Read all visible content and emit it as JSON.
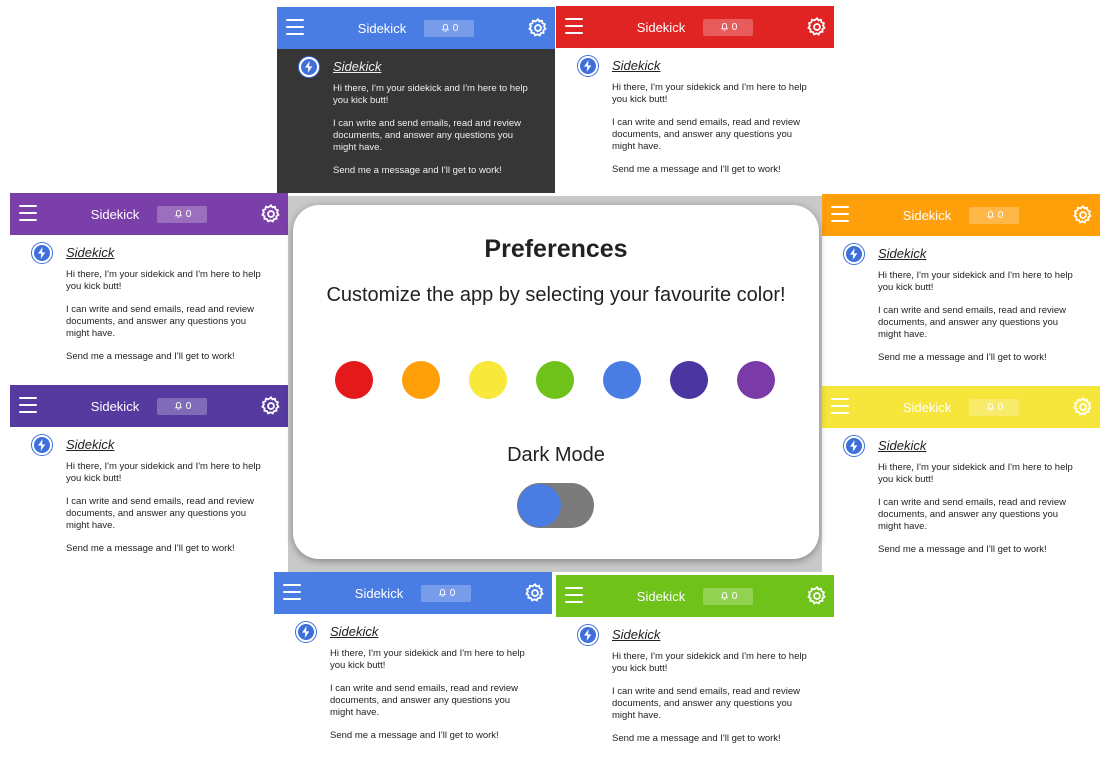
{
  "panel_text": {
    "title": "Sidekick",
    "bell_count": "0",
    "bot_name": "Sidekick",
    "msg1": "Hi there, I'm your sidekick and I'm here to help you kick butt!",
    "msg2": "I can write and send emails, read and review documents, and answer any questions you might have.",
    "msg3": "Send me a message and I'll get to work!"
  },
  "panels": [
    {
      "id": "blue-dark",
      "color": "#4a7de3",
      "dark": true
    },
    {
      "id": "red",
      "color": "#e02424"
    },
    {
      "id": "purple",
      "color": "#7a3fa8"
    },
    {
      "id": "orange",
      "color": "#ff9f0a"
    },
    {
      "id": "indigo",
      "color": "#563aa0"
    },
    {
      "id": "yellow",
      "color": "#f6e53a"
    },
    {
      "id": "blue",
      "color": "#4a7de3"
    },
    {
      "id": "green",
      "color": "#6fc21a"
    }
  ],
  "preferences": {
    "title": "Preferences",
    "subtitle": "Customize the app by selecting your favourite color!",
    "dark_mode_label": "Dark Mode",
    "dark_mode_on": true
  },
  "swatches": [
    {
      "name": "red",
      "color": "#e41a1a"
    },
    {
      "name": "orange",
      "color": "#ff9f0a"
    },
    {
      "name": "yellow",
      "color": "#f7e83a"
    },
    {
      "name": "green",
      "color": "#6fc21a"
    },
    {
      "name": "blue",
      "color": "#4a7de3"
    },
    {
      "name": "indigo",
      "color": "#4b35a0"
    },
    {
      "name": "purple",
      "color": "#7a3aa8"
    }
  ]
}
